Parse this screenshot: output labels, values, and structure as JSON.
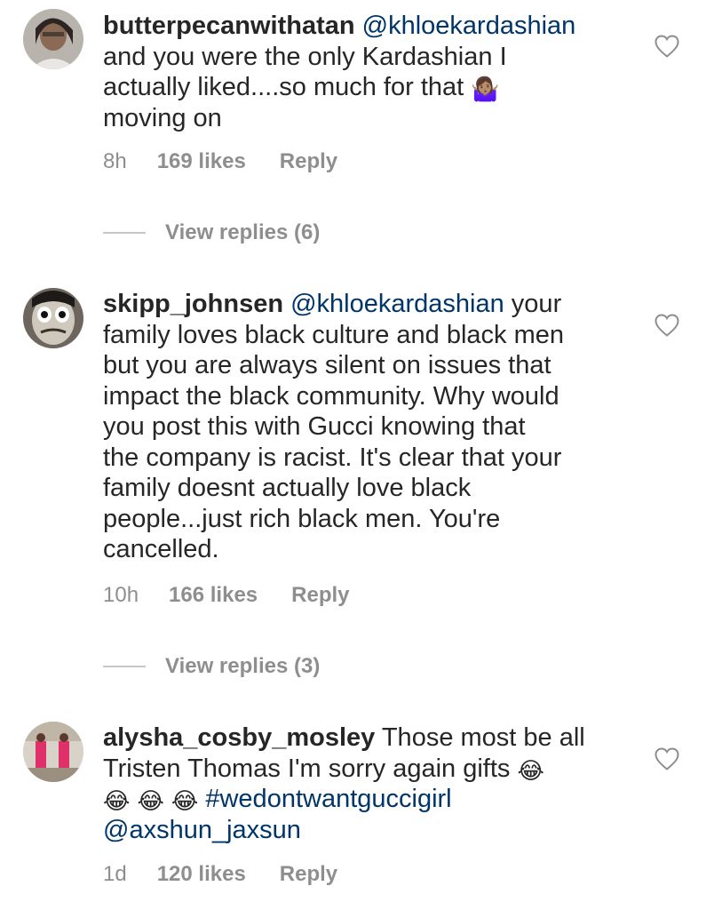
{
  "comments": [
    {
      "username": "butterpecanwithatan",
      "mention": "@khloekardashian",
      "text_line1_rest": "",
      "lines": [
        "and you were the only Kardashian I",
        "actually liked....so much for that",
        "moving on"
      ],
      "emoji": "🤷🏽‍♀️",
      "emoji_icon": "shrug-emoji",
      "time": "8h",
      "likes": "169 likes",
      "reply": "Reply",
      "view_replies": "View replies (6)"
    },
    {
      "username": "skipp_johnsen",
      "mention": "@khloekardashian",
      "text_line1_rest": " your",
      "lines": [
        "family loves black culture and black men",
        "but you are always silent on issues that",
        "impact the black community. Why would",
        "you post this with Gucci knowing that",
        "the company is racist. It's clear that your",
        "family doesnt actually love black",
        "people...just rich black men. You're",
        "cancelled."
      ],
      "time": "10h",
      "likes": "166 likes",
      "reply": "Reply",
      "view_replies": "View replies (3)"
    },
    {
      "username": "alysha_cosby_mosley",
      "text_line1_rest": " Those most be all",
      "line2": "Tristen Thomas I'm sorry again gifts ",
      "emoji": "😂",
      "emoji_icon": "laughing-tears-emoji",
      "hashtag": "#wedontwantguccigirl",
      "mention2": "@axshun_jaxsun",
      "time": "1d",
      "likes": "120 likes",
      "reply": "Reply"
    }
  ],
  "icons": {
    "like": "heart-outline-icon",
    "line": "replies-line"
  },
  "colors": {
    "text": "#262626",
    "meta": "#8e8e8e",
    "mention": "#003569",
    "heart": "#8e8e8e"
  }
}
